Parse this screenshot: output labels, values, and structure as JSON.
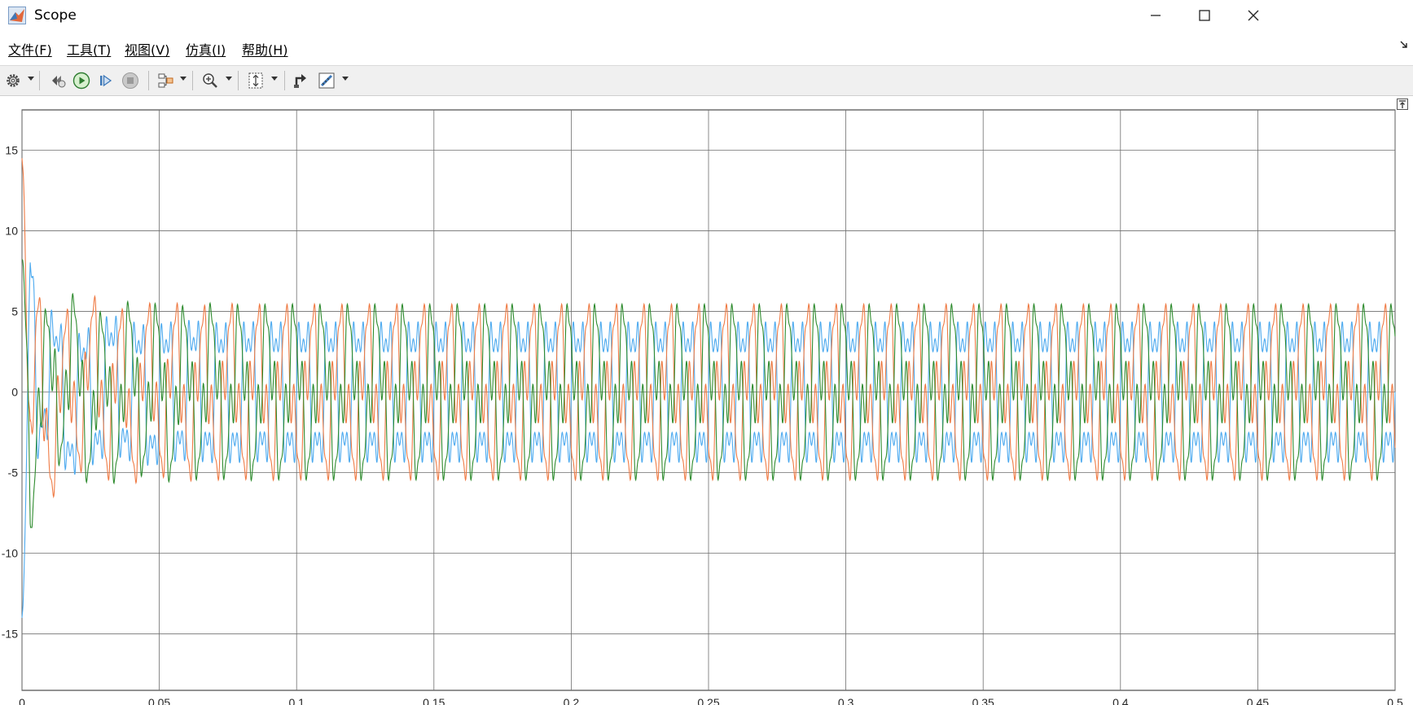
{
  "window": {
    "title": "Scope",
    "minimize_icon": "minimize-icon",
    "maximize_icon": "maximize-icon",
    "close_icon": "close-icon"
  },
  "menu": [
    {
      "label": "文件(F)"
    },
    {
      "label": "工具(T)"
    },
    {
      "label": "视图(V)"
    },
    {
      "label": "仿真(I)"
    },
    {
      "label": "帮助(H)"
    }
  ],
  "toolbar": {
    "icons": [
      "settings-gear-icon",
      "step-back-icon",
      "run-icon",
      "step-forward-icon",
      "stop-icon",
      "signal-select-icon",
      "zoom-in-icon",
      "autoscale-icon",
      "highlight-block-icon",
      "measurement-icon"
    ]
  },
  "colors": {
    "series_blue": "#4DAAEF",
    "series_orange": "#EF7B45",
    "series_green": "#2E8B2E",
    "grid": "#6e6e6e",
    "toolbar_bg": "#f0f0f0"
  },
  "chart_data": {
    "type": "line",
    "title": "",
    "xlabel": "",
    "ylabel": "",
    "xlim": [
      0,
      0.5
    ],
    "ylim": [
      -18.5,
      17.5
    ],
    "grid": true,
    "x_ticks": [
      0,
      0.05,
      0.1,
      0.15,
      0.2,
      0.25,
      0.3,
      0.35,
      0.4,
      0.45,
      0.5
    ],
    "x_tick_labels": [
      "0",
      "0.05",
      "0.1",
      "0.15",
      "0.2",
      "0.25",
      "0.3",
      "0.35",
      "0.4",
      "0.45",
      "0.5"
    ],
    "y_ticks": [
      -15,
      -10,
      -5,
      0,
      5,
      10,
      15
    ],
    "y_tick_labels": [
      "-15",
      "-10",
      "-5",
      "0",
      "5",
      "10",
      "15"
    ],
    "series": [
      {
        "color": "#4DAAEF",
        "phase_deg": 0,
        "steady_peak": 6.2,
        "steady_trough": -6.2,
        "initial_extreme": -14.0
      },
      {
        "color": "#EF7B45",
        "phase_deg": -120,
        "steady_peak": 6.2,
        "steady_trough": -6.2,
        "initial_extreme": 14.5
      },
      {
        "color": "#2E8B2E",
        "phase_deg": 120,
        "steady_peak": 6.2,
        "steady_trough": -6.2,
        "initial_extreme": 8.2
      }
    ],
    "fundamental_hz": 100,
    "harmonic_ratio": 0.45,
    "settling_time_s": 0.08
  }
}
